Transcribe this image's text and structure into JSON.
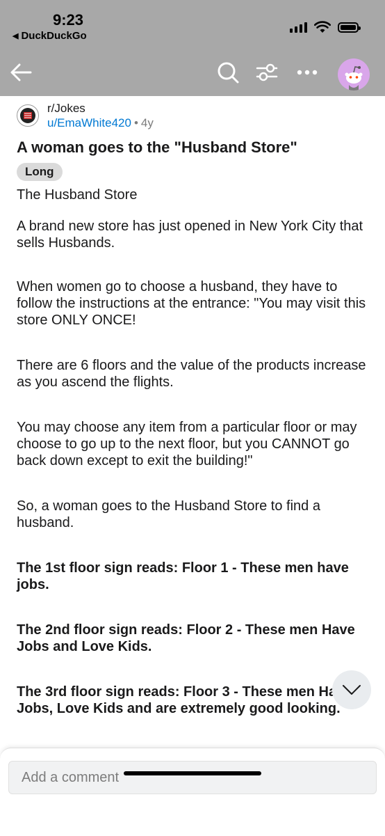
{
  "status_bar": {
    "time": "9:23",
    "back_app": "DuckDuckGo",
    "icons": [
      "signal-icon",
      "wifi-icon",
      "battery-icon"
    ]
  },
  "header": {
    "icons": [
      "back-arrow-icon",
      "search-icon",
      "filter-icon",
      "more-icon",
      "avatar"
    ]
  },
  "post": {
    "subreddit": "r/Jokes",
    "username": "u/EmaWhite420",
    "separator": "•",
    "age": "4y",
    "title": "A woman goes to the \"Husband Store\"",
    "flair": "Long",
    "paragraphs": [
      "The Husband Store",
      "A brand new store has just opened in New York City that sells Husbands.",
      "When women go to choose a husband, they have to follow the instructions at the entrance: \"You may visit this store ONLY ONCE!",
      "There are 6 floors and the value of the products increase as you ascend the flights.",
      "You may choose any item from a particular floor or may choose to go up to the next floor, but you CANNOT go back down except to exit the building!\"",
      "So, a woman goes to the Husband Store to find a husband.",
      "The 1st floor sign reads: Floor 1 - These men have jobs.",
      "The 2nd floor sign reads: Floor 2 - These men Have Jobs and Love Kids.",
      "The 3rd floor sign reads: Floor 3 - These men Have Jobs, Love Kids and are extremely good looking."
    ]
  },
  "comment": {
    "placeholder": "Add a comment"
  },
  "colors": {
    "header_bg": "#a8a8a8",
    "link": "#0079d3",
    "avatar_bg": "#d9a6ea",
    "flair_bg": "#dadada"
  }
}
